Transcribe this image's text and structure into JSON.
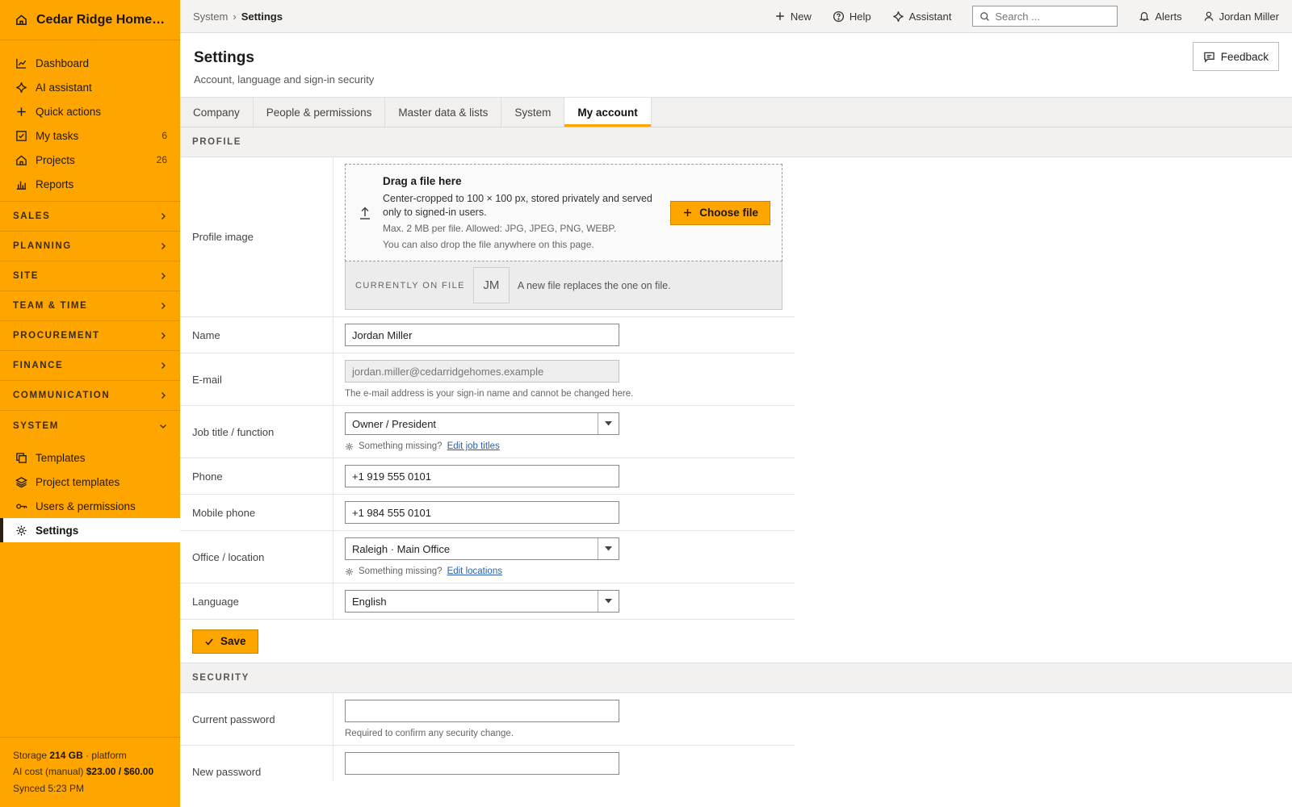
{
  "brand": {
    "name": "Cedar Ridge Homes L..."
  },
  "sidebar": {
    "primary": [
      {
        "label": "Dashboard",
        "icon": "chart-line-icon",
        "count": ""
      },
      {
        "label": "AI assistant",
        "icon": "sparkle-icon",
        "count": ""
      },
      {
        "label": "Quick actions",
        "icon": "plus-icon",
        "count": ""
      },
      {
        "label": "My tasks",
        "icon": "checkbox-icon",
        "count": "6"
      },
      {
        "label": "Projects",
        "icon": "home-icon",
        "count": "26"
      },
      {
        "label": "Reports",
        "icon": "bar-chart-icon",
        "count": ""
      }
    ],
    "sections": [
      "SALES",
      "PLANNING",
      "SITE",
      "TEAM & TIME",
      "PROCUREMENT",
      "FINANCE",
      "COMMUNICATION"
    ],
    "system_section": "SYSTEM",
    "system_items": [
      {
        "label": "Templates",
        "icon": "copy-icon"
      },
      {
        "label": "Project templates",
        "icon": "layers-icon"
      },
      {
        "label": "Users & permissions",
        "icon": "key-icon"
      },
      {
        "label": "Settings",
        "icon": "gear-icon"
      }
    ],
    "footer": {
      "storage_label": "Storage",
      "storage_value": "214 GB",
      "storage_suffix": "· platform",
      "ai_label": "AI cost (manual)",
      "ai_value": "$23.00 / $60.00",
      "synced": "Synced 5:23 PM"
    }
  },
  "topbar": {
    "breadcrumb": [
      "System",
      "Settings"
    ],
    "new_label": "New",
    "help_label": "Help",
    "assistant_label": "Assistant",
    "search_placeholder": "Search ...",
    "alerts_label": "Alerts",
    "user_label": "Jordan Miller"
  },
  "page": {
    "title": "Settings",
    "subtitle": "Account, language and sign-in security",
    "feedback_label": "Feedback"
  },
  "tabs": [
    "Company",
    "People & permissions",
    "Master data & lists",
    "System",
    "My account"
  ],
  "active_tab": "My account",
  "profile": {
    "section_label": "PROFILE",
    "image_label": "Profile image",
    "drop_title": "Drag a file here",
    "drop_desc": "Center-cropped to 100 × 100 px, stored privately and served only to signed-in users.",
    "drop_limits": "Max. 2 MB per file. Allowed: JPG, JPEG, PNG, WEBP.",
    "drop_hint": "You can also drop the file anywhere on this page.",
    "choose_label": "Choose file",
    "on_file_label": "CURRENTLY ON FILE",
    "avatar_initials": "JM",
    "on_file_note": "A new file replaces the one on file.",
    "name_label": "Name",
    "name_value": "Jordan Miller",
    "email_label": "E-mail",
    "email_value": "jordan.miller@cedarridgehomes.example",
    "email_hint": "The e-mail address is your sign-in name and cannot be changed here.",
    "job_label": "Job title / function",
    "job_value": "Owner / President",
    "missing_text": "Something missing?",
    "job_link": "Edit job titles",
    "phone_label": "Phone",
    "phone_value": "+1 919 555 0101",
    "mobile_label": "Mobile phone",
    "mobile_value": "+1 984 555 0101",
    "office_label": "Office / location",
    "office_value": "Raleigh · Main Office",
    "office_link": "Edit locations",
    "language_label": "Language",
    "language_value": "English",
    "save_label": "Save"
  },
  "security": {
    "section_label": "SECURITY",
    "current_label": "Current password",
    "current_hint": "Required to confirm any security change.",
    "new_label": "New password"
  },
  "colors": {
    "accent": "#FFA500",
    "link": "#2b5fa8"
  }
}
